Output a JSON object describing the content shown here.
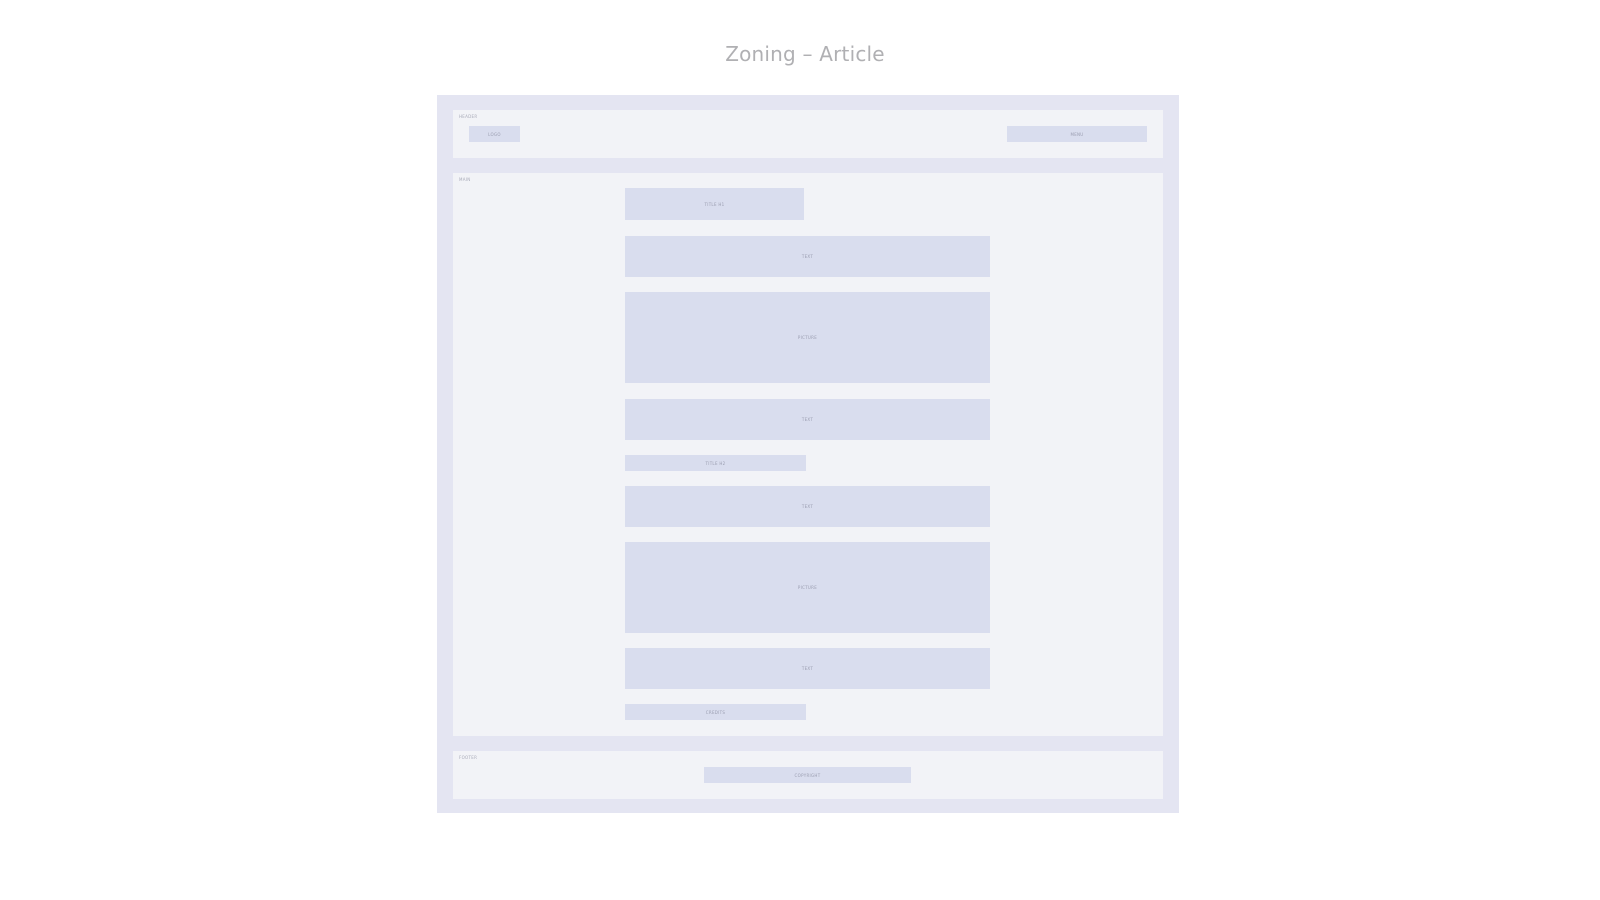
{
  "title": "Zoning – Article",
  "header": {
    "label": "HEADER",
    "logo": "LOGO",
    "menu": "MENU"
  },
  "main": {
    "label": "MAIN",
    "title_h1": "TITLE H1",
    "text_1": "TEXT",
    "picture_1": "PICTURE",
    "text_2": "TEXT",
    "title_h2": "TITLE H2",
    "text_3": "TEXT",
    "picture_2": "PICTURE",
    "text_4": "TEXT",
    "credits": "CREDITS"
  },
  "footer": {
    "label": "FOOTER",
    "copyright": "COPYRIGHT"
  },
  "colors": {
    "frame": "#e4e5f2",
    "zone": "#f2f3f7",
    "block": "#d9ddee",
    "title_text": "#b0b0b3"
  }
}
